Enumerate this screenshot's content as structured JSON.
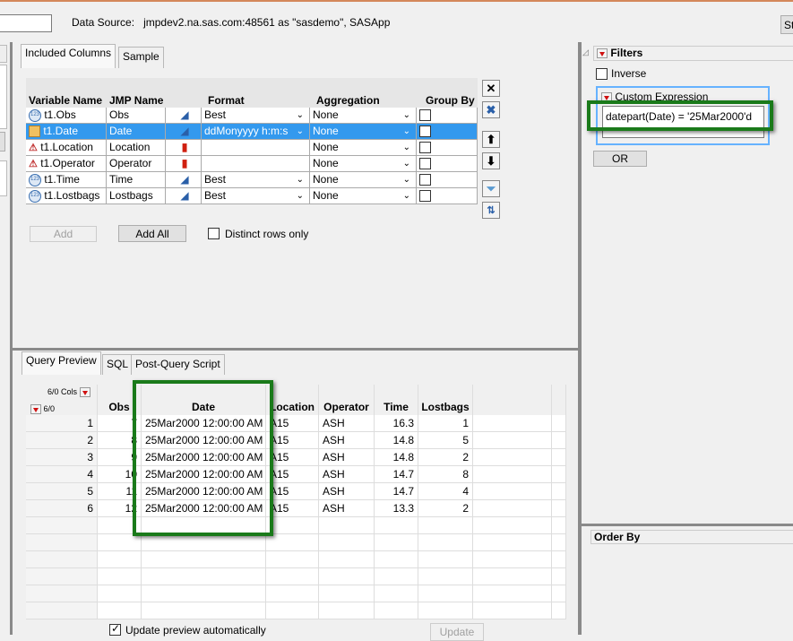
{
  "header": {
    "data_source_label": "Data Source:",
    "data_source_value": "jmpdev2.na.sas.com:48561 as \"sasdemo\", SASApp",
    "right_button": "St"
  },
  "columns_tabs": [
    {
      "label": "Included Columns",
      "active": true
    },
    {
      "label": "Sample",
      "active": false
    }
  ],
  "columns_table": {
    "headers": [
      "Variable Name",
      "JMP Name",
      "Format",
      "Aggregation",
      "Group By"
    ],
    "rows": [
      {
        "variable": "t1.Obs",
        "jmp_name": "Obs",
        "type_icon": "numeric-icon",
        "model_icon": "continuous-icon",
        "format": "Best",
        "aggregation": "None",
        "group_by": false,
        "selected": false
      },
      {
        "variable": "t1.Date",
        "jmp_name": "Date",
        "type_icon": "date-icon",
        "model_icon": "continuous-icon",
        "format": "ddMonyyyy h:m:s",
        "aggregation": "None",
        "group_by": false,
        "selected": true
      },
      {
        "variable": "t1.Location",
        "jmp_name": "Location",
        "type_icon": "character-icon",
        "model_icon": "nominal-icon",
        "format": "",
        "aggregation": "None",
        "group_by": false,
        "selected": false
      },
      {
        "variable": "t1.Operator",
        "jmp_name": "Operator",
        "type_icon": "character-icon",
        "model_icon": "nominal-icon",
        "format": "",
        "aggregation": "None",
        "group_by": false,
        "selected": false
      },
      {
        "variable": "t1.Time",
        "jmp_name": "Time",
        "type_icon": "numeric-icon",
        "model_icon": "continuous-icon",
        "format": "Best",
        "aggregation": "None",
        "group_by": false,
        "selected": false
      },
      {
        "variable": "t1.Lostbags",
        "jmp_name": "Lostbags",
        "type_icon": "numeric-icon",
        "model_icon": "continuous-icon",
        "format": "Best",
        "aggregation": "None",
        "group_by": false,
        "selected": false
      }
    ]
  },
  "actions": {
    "add": "Add",
    "add_all": "Add All",
    "distinct": "Distinct rows only"
  },
  "preview_tabs": [
    {
      "label": "Query Preview",
      "active": true
    },
    {
      "label": "SQL",
      "active": false
    },
    {
      "label": "Post-Query Script",
      "active": false
    }
  ],
  "preview": {
    "cols_label": "6/0 Cols",
    "rows_label": "6/0",
    "headers": [
      "Obs",
      "Date",
      "Location",
      "Operator",
      "Time",
      "Lostbags"
    ],
    "rows": [
      [
        "1",
        "7",
        "25Mar2000 12:00:00 AM",
        "A15",
        "ASH",
        "16.3",
        "1"
      ],
      [
        "2",
        "8",
        "25Mar2000 12:00:00 AM",
        "A15",
        "ASH",
        "14.8",
        "5"
      ],
      [
        "3",
        "9",
        "25Mar2000 12:00:00 AM",
        "A15",
        "ASH",
        "14.8",
        "2"
      ],
      [
        "4",
        "10",
        "25Mar2000 12:00:00 AM",
        "A15",
        "ASH",
        "14.7",
        "8"
      ],
      [
        "5",
        "11",
        "25Mar2000 12:00:00 AM",
        "A15",
        "ASH",
        "14.7",
        "4"
      ],
      [
        "6",
        "12",
        "25Mar2000 12:00:00 AM",
        "A15",
        "ASH",
        "13.3",
        "2"
      ]
    ],
    "update_auto": "Update preview automatically",
    "update_auto_checked": true,
    "update": "Update"
  },
  "filters": {
    "title": "Filters",
    "inverse": "Inverse",
    "custom_expression": "Custom Expression",
    "expression": "datepart(Date) = '25Mar2000'd",
    "or": "OR"
  },
  "order_by": {
    "title": "Order By"
  },
  "colors": {
    "selection": "#3399ee",
    "highlight": "#1a7a1a",
    "focus": "#55aaff"
  }
}
